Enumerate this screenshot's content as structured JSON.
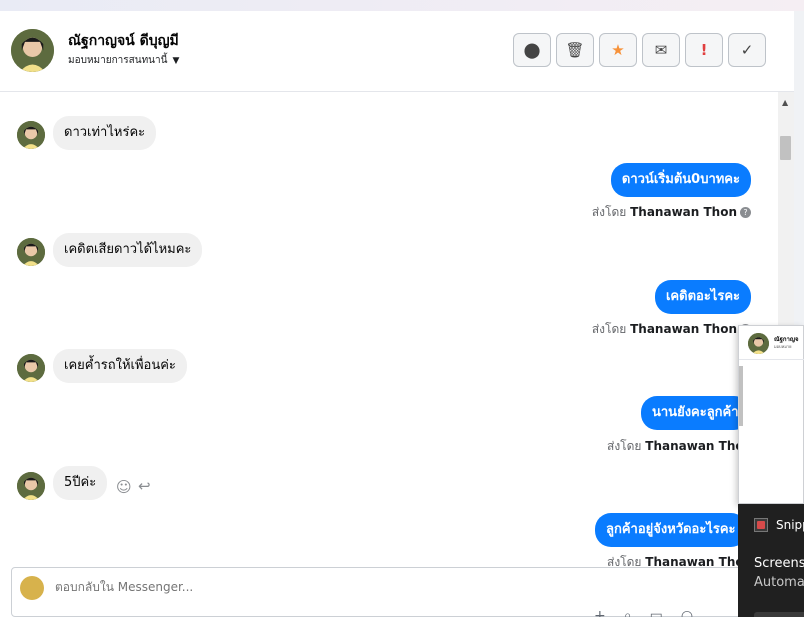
{
  "conversation": {
    "contact_name": "ณัฐกาญจน์ ดีบุญมี",
    "assign_label": "มอบหมายการสนทนานี้",
    "actions": [
      {
        "name": "report-button",
        "icon": "!",
        "style": ""
      },
      {
        "name": "delete-button",
        "icon": "🗑",
        "style": ""
      },
      {
        "name": "star-button",
        "icon": "★",
        "style": "star"
      },
      {
        "name": "mark-unread-button",
        "icon": "✉",
        "style": ""
      },
      {
        "name": "priority-button",
        "icon": "!",
        "style": "excl"
      },
      {
        "name": "done-button",
        "icon": "✓",
        "style": ""
      }
    ]
  },
  "messages": {
    "m1": "ดาวเท่าไหร่คะ",
    "m2": "ดาวน์เริ่มต้น0บาทคะ",
    "m3": "เคดิตเสียดาวได้ไหมคะ",
    "m4": "เคดิตอะไรคะ",
    "m5": "เคยค้ำรถให้เพื่อนค่ะ",
    "m6": "นานยังคะลูกค้า",
    "m7": "5ปีค่ะ",
    "m8": "ลูกค้าอยู่จังหวัดอะไรคะ"
  },
  "sent_by": {
    "prefix": "ส่งโดย",
    "agent": "Thanawan Thon",
    "info_icon": "?"
  },
  "composer": {
    "placeholder": "ตอบกลับใน Messenger..."
  },
  "popup": {
    "name": "ณัฐกาญจ",
    "sub": "มอบหมาย"
  },
  "notification": {
    "app": "Snipp",
    "title": "Screensh",
    "body": "Automat"
  }
}
